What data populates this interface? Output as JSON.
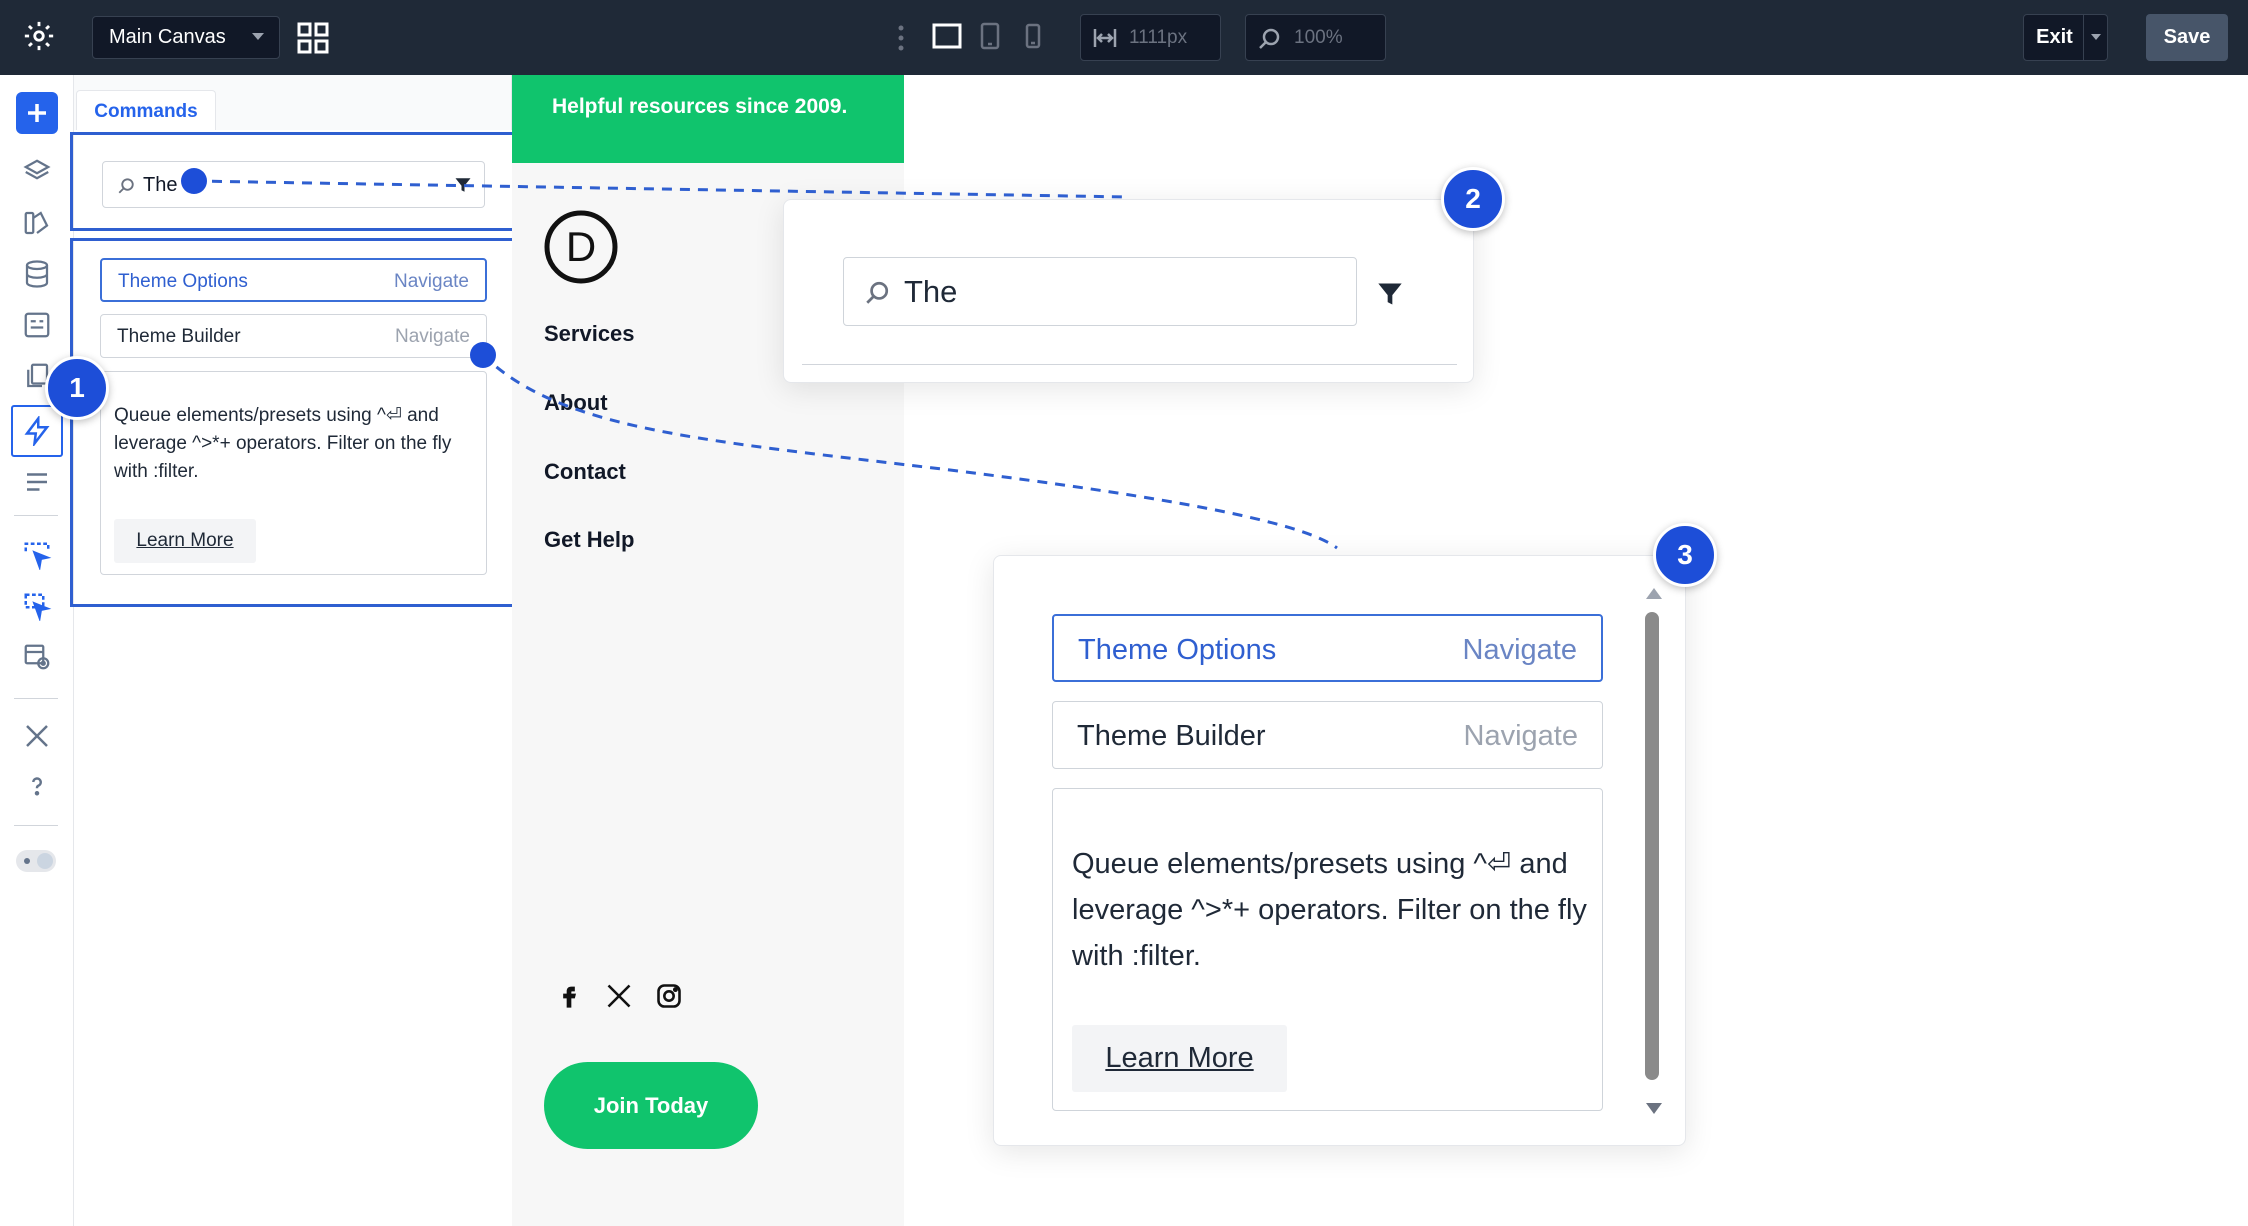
{
  "topbar": {
    "canvas_select": "Main Canvas",
    "width_value": "1111px",
    "zoom_value": "100%",
    "exit_label": "Exit",
    "save_label": "Save"
  },
  "panel": {
    "tab_label": "Commands",
    "search_value": "The",
    "results": [
      {
        "label": "Theme Options",
        "action": "Navigate",
        "active": true
      },
      {
        "label": "Theme Builder",
        "action": "Navigate",
        "active": false
      }
    ],
    "info_text": "Queue elements/presets using ^⏎ and leverage ^>*+ operators. Filter on the fly with :filter.",
    "learn_more": "Learn More"
  },
  "site": {
    "banner_text": "Helpful resources since 2009.",
    "logo_letter": "D",
    "nav": [
      "Services",
      "About",
      "Contact",
      "Get Help"
    ],
    "cta": "Join Today"
  },
  "callouts": {
    "badge_1": "1",
    "badge_2": "2",
    "badge_3": "3",
    "zoom_search_value": "The",
    "zoom_results": [
      {
        "label": "Theme Options",
        "action": "Navigate"
      },
      {
        "label": "Theme Builder",
        "action": "Navigate"
      }
    ],
    "zoom_info_text": "Queue elements/presets using ^⏎ and leverage ^>*+ operators. Filter on the fly with :filter.",
    "zoom_learn_more": "Learn More"
  },
  "colors": {
    "accent": "#2563eb",
    "topbar": "#1f2937",
    "brand_green": "#10c46d"
  }
}
